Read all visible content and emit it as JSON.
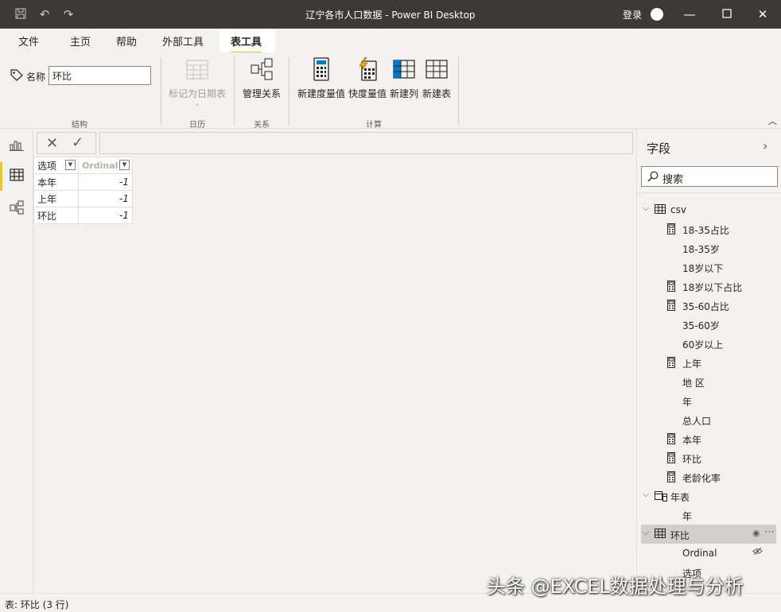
{
  "window": {
    "title": "辽宁各市人口数据 - Power BI Desktop",
    "login": "登录"
  },
  "tabs": [
    "文件",
    "主页",
    "帮助",
    "外部工具",
    "表工具"
  ],
  "ribbon": {
    "name_label": "名称",
    "name_value": "环比",
    "mark_date_table": "标记为日期表",
    "manage_relations": "管理关系",
    "new_measure": "新建度量值",
    "quick_measure": "快度量值",
    "new_column": "新建列",
    "new_table": "新建表",
    "groups": [
      "结构",
      "日历",
      "关系",
      "计算"
    ]
  },
  "grid": {
    "headers": [
      "选项",
      "Ordinal"
    ],
    "rows": [
      [
        "本年",
        "-1"
      ],
      [
        "上年",
        "-1"
      ],
      [
        "环比",
        "-1"
      ]
    ]
  },
  "fields": {
    "title": "字段",
    "search_placeholder": "搜索",
    "items": [
      {
        "label": "csv",
        "kind": "table",
        "indent": 0
      },
      {
        "label": "18-35占比",
        "kind": "measure",
        "indent": 1
      },
      {
        "label": "18-35岁",
        "kind": "column",
        "indent": 1
      },
      {
        "label": "18岁以下",
        "kind": "column",
        "indent": 1
      },
      {
        "label": "18岁以下占比",
        "kind": "measure",
        "indent": 1
      },
      {
        "label": "35-60占比",
        "kind": "measure",
        "indent": 1
      },
      {
        "label": "35-60岁",
        "kind": "column",
        "indent": 1
      },
      {
        "label": "60岁以上",
        "kind": "column",
        "indent": 1
      },
      {
        "label": "上年",
        "kind": "measure",
        "indent": 1
      },
      {
        "label": "地 区",
        "kind": "column",
        "indent": 1
      },
      {
        "label": "年",
        "kind": "column",
        "indent": 1
      },
      {
        "label": "总人口",
        "kind": "column",
        "indent": 1
      },
      {
        "label": "本年",
        "kind": "measure",
        "indent": 1
      },
      {
        "label": "环比",
        "kind": "measure",
        "indent": 1
      },
      {
        "label": "老龄化率",
        "kind": "measure",
        "indent": 1
      },
      {
        "label": "年表",
        "kind": "calendar",
        "indent": 0
      },
      {
        "label": "年",
        "kind": "column",
        "indent": 1
      },
      {
        "label": "环比",
        "kind": "table",
        "indent": 0,
        "selected": true
      },
      {
        "label": "Ordinal",
        "kind": "column",
        "indent": 1,
        "hidden": true
      },
      {
        "label": "选项",
        "kind": "column",
        "indent": 1
      }
    ]
  },
  "status": "表: 环比 (3 行)",
  "watermark": "头条 @EXCEL数据处理与分析",
  "colors": {
    "accent": "#f2c811",
    "titlebar": "#3b3a39",
    "background": "#f3f2f1"
  }
}
